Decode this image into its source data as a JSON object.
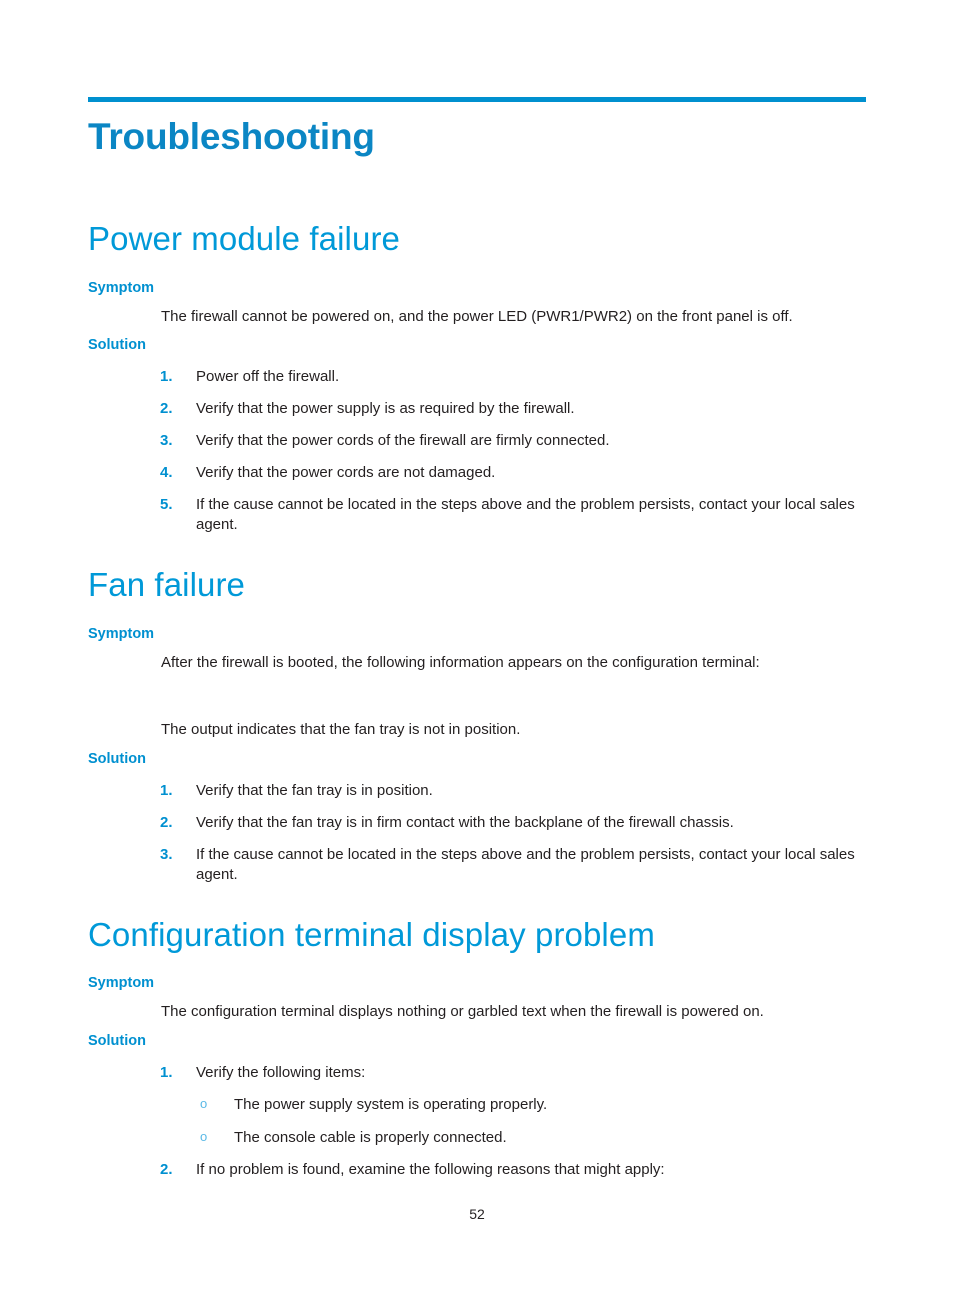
{
  "document": {
    "page_number": "52",
    "accent_color": "#0090cf",
    "heading_color": "#0099d8",
    "title_color": "#0b86c4",
    "body_color": "#231f20",
    "bullet_color": "#5ab9e6"
  },
  "chapter": {
    "title": "Troubleshooting"
  },
  "labels": {
    "symptom": "Symptom",
    "solution": "Solution",
    "bullet_marker": "o"
  },
  "sections": [
    {
      "heading": "Power module failure",
      "symptom_heading": "Symptom",
      "symptom_text": "The firewall cannot be powered on, and the power LED (PWR1/PWR2) on the front panel is off.",
      "solution_heading": "Solution",
      "steps": [
        {
          "marker": "1.",
          "text": "Power off the firewall."
        },
        {
          "marker": "2.",
          "text": "Verify that the power supply is as required by the firewall."
        },
        {
          "marker": "3.",
          "text": "Verify that the power cords of the firewall are firmly connected."
        },
        {
          "marker": "4.",
          "text": "Verify that the power cords are not damaged."
        },
        {
          "marker": "5.",
          "text": "If the cause cannot be located in the steps above and the problem persists, contact your local sales agent."
        }
      ]
    },
    {
      "heading": "Fan failure",
      "symptom_heading": "Symptom",
      "symptom_text": "After the firewall is booted, the following information appears on the configuration terminal:",
      "symptom_text_2": "The output indicates that the fan tray is not in position.",
      "solution_heading": "Solution",
      "steps": [
        {
          "marker": "1.",
          "text": "Verify that the fan tray is in position."
        },
        {
          "marker": "2.",
          "text": "Verify that the fan tray is in firm contact with the backplane of the firewall chassis."
        },
        {
          "marker": "3.",
          "text": "If the cause cannot be located in the steps above and the problem persists, contact your local sales agent."
        }
      ]
    },
    {
      "heading": "Configuration terminal display problem",
      "symptom_heading": "Symptom",
      "symptom_text": "The configuration terminal displays nothing or garbled text when the firewall is powered on.",
      "solution_heading": "Solution",
      "steps": [
        {
          "marker": "1.",
          "text": "Verify the following items:"
        },
        {
          "marker": "2.",
          "text": "If no problem is found, examine the following reasons that might apply:"
        }
      ],
      "substeps": [
        {
          "marker": "o",
          "text": "The power supply system is operating properly."
        },
        {
          "marker": "o",
          "text": "The console cable is properly connected."
        }
      ]
    }
  ]
}
